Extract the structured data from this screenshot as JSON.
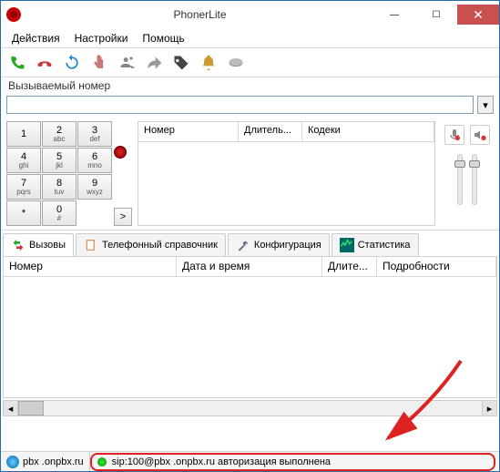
{
  "window": {
    "title": "PhonerLite"
  },
  "menu": {
    "actions": "Действия",
    "settings": "Настройки",
    "help": "Помощь"
  },
  "label_dialed": "Вызываемый номер",
  "number_value": "",
  "dialpad": [
    {
      "n": "1",
      "l": ""
    },
    {
      "n": "2",
      "l": "abc"
    },
    {
      "n": "3",
      "l": "def"
    },
    {
      "n": "4",
      "l": "ghi"
    },
    {
      "n": "5",
      "l": "jkl"
    },
    {
      "n": "6",
      "l": "mno"
    },
    {
      "n": "7",
      "l": "pqrs"
    },
    {
      "n": "8",
      "l": "tuv"
    },
    {
      "n": "9",
      "l": "wxyz"
    },
    {
      "n": "*",
      "l": ""
    },
    {
      "n": "0",
      "l": "#"
    },
    {
      "n": "",
      "l": ""
    }
  ],
  "redial_btn": ">",
  "call_list": {
    "col_number": "Номер",
    "col_duration": "Длитель...",
    "col_codecs": "Кодеки"
  },
  "tabs": {
    "calls": "Вызовы",
    "phonebook": "Телефонный справочник",
    "config": "Конфигурация",
    "stats": "Статистика"
  },
  "grid": {
    "col_number": "Номер",
    "col_datetime": "Дата и время",
    "col_duration": "Длите...",
    "col_details": "Подробности"
  },
  "status": {
    "server": "pbx       .onpbx.ru",
    "message": "sip:100@pbx       .onpbx.ru авторизация выполнена"
  }
}
